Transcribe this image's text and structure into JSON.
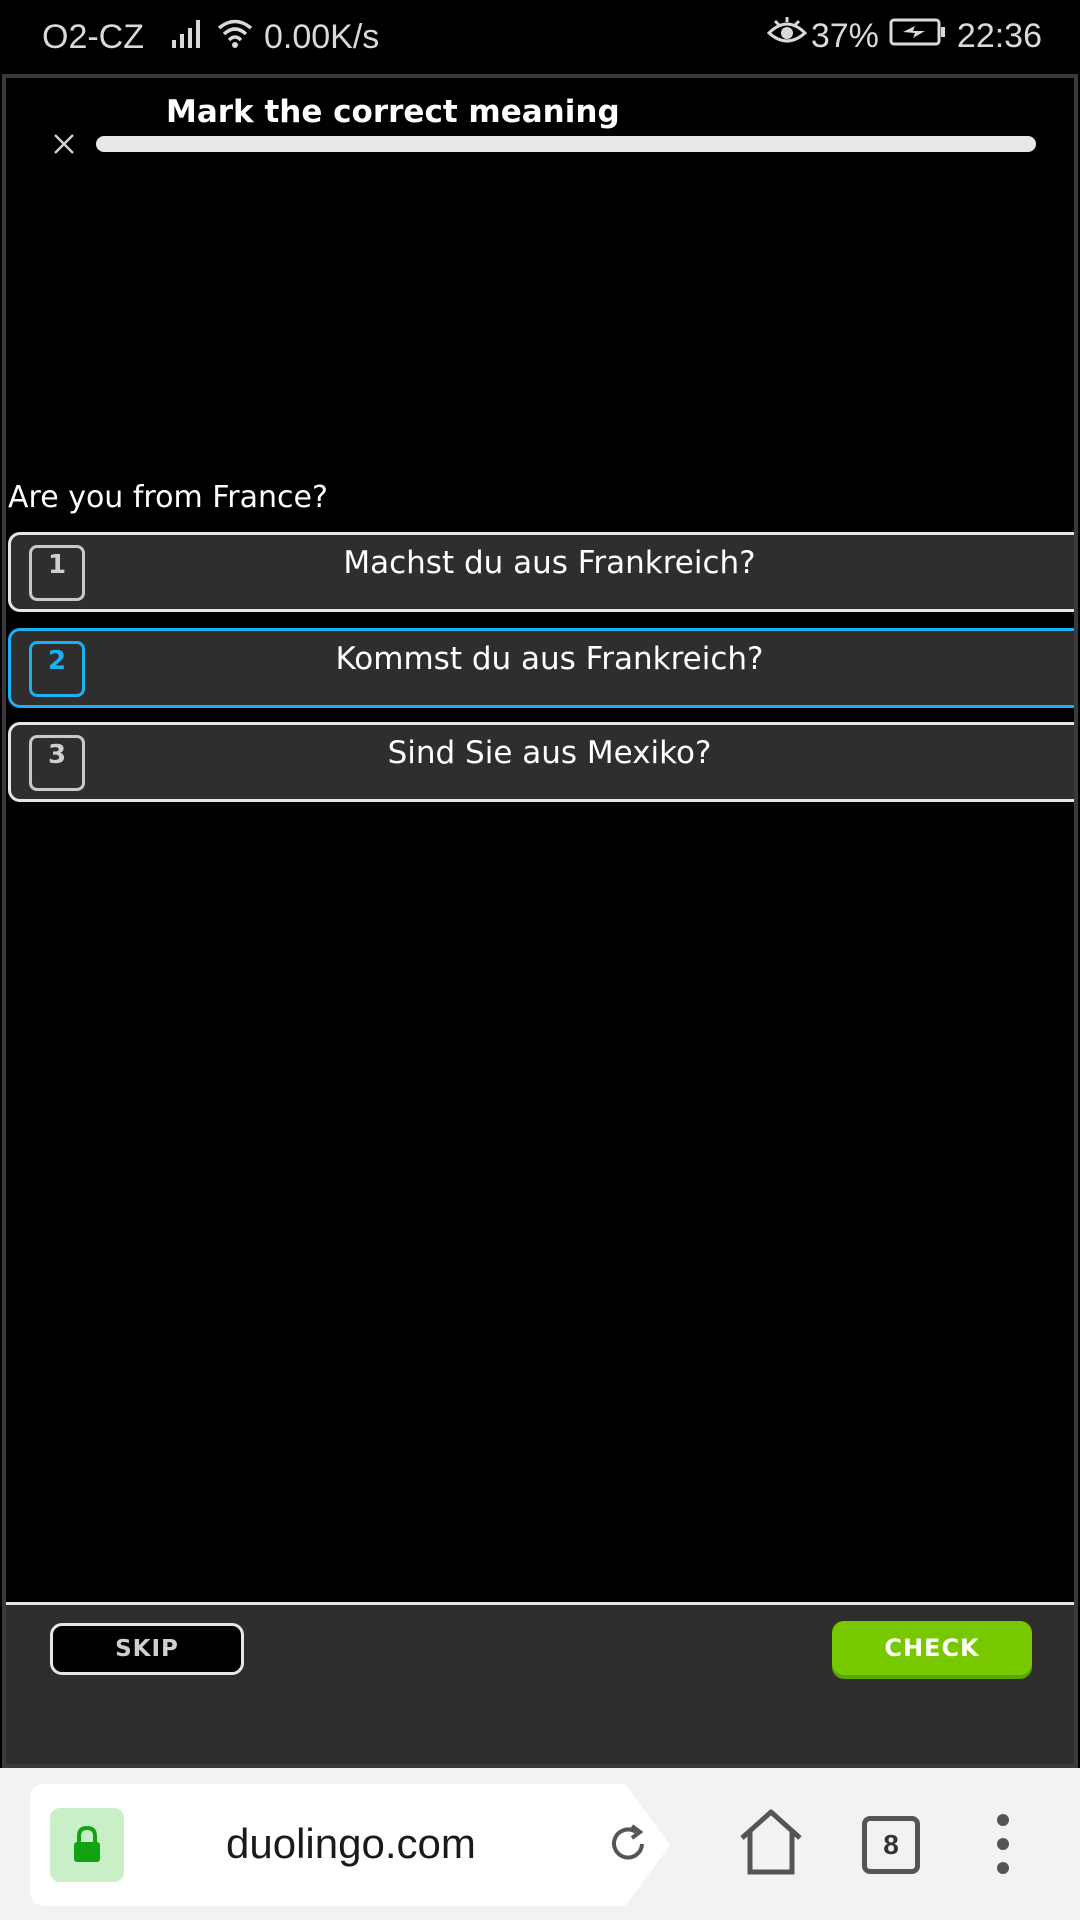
{
  "status_bar": {
    "carrier": "O2-CZ",
    "network_speed": "0.00K/s",
    "battery": "37%",
    "time": "22:36",
    "icons": [
      "signal-icon",
      "wifi-icon",
      "eye-icon",
      "battery-charging-icon"
    ]
  },
  "lesson": {
    "title": "Mark the correct meaning",
    "progress": 0,
    "prompt": "Are you from France?",
    "options": [
      {
        "key": "1",
        "text": "Machst du aus Frankreich?",
        "selected": false
      },
      {
        "key": "2",
        "text": "Kommst du aus Frankreich?",
        "selected": true
      },
      {
        "key": "3",
        "text": "Sind Sie aus Mexiko?",
        "selected": false
      }
    ]
  },
  "footer": {
    "skip_label": "SKIP",
    "check_label": "CHECK"
  },
  "browser": {
    "url": "duolingo.com",
    "tab_count": "8"
  },
  "colors": {
    "accent_blue": "#1cb0f6",
    "check_green": "#78c800",
    "panel_gray": "#2f2e2c"
  }
}
